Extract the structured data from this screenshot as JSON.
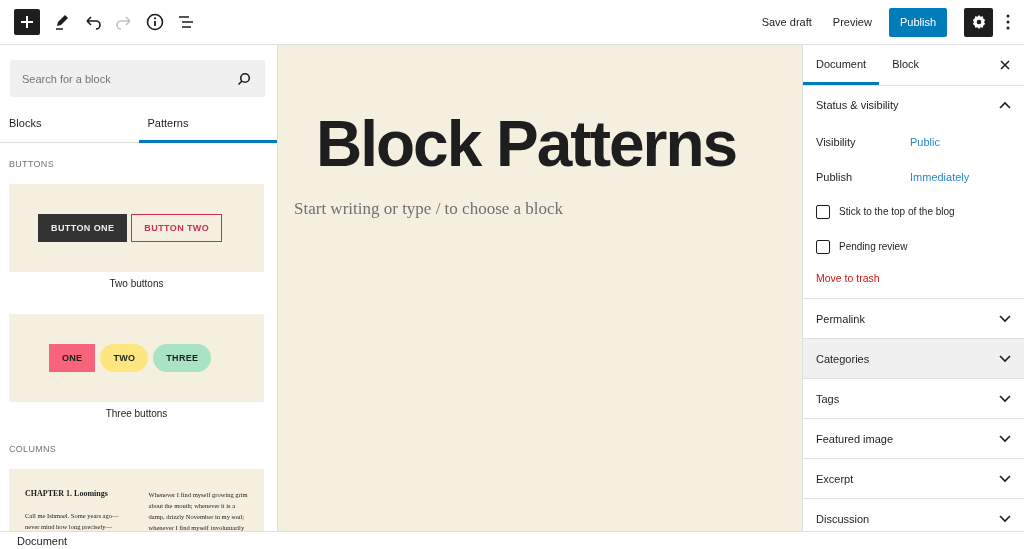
{
  "top_bar": {
    "save_draft": "Save draft",
    "preview": "Preview",
    "publish": "Publish",
    "settings_active": true
  },
  "inserter": {
    "search": {
      "placeholder": "Search for a block"
    },
    "tabs": [
      {
        "label": "Blocks",
        "selected": false
      },
      {
        "label": "Patterns",
        "selected": true
      }
    ],
    "categories": [
      {
        "heading": "BUTTONS",
        "patterns": [
          {
            "kind": "buttons",
            "label": "Two buttons",
            "buttons": [
              {
                "label": "BUTTON ONE",
                "kind": "filled"
              },
              {
                "label": "BUTTON TWO",
                "kind": "outline"
              }
            ]
          },
          {
            "kind": "pills",
            "label": "Three buttons",
            "buttons": [
              {
                "label": "ONE",
                "color": "#f7637a",
                "kind": "square"
              },
              {
                "label": "TWO",
                "color": "#fde680",
                "kind": "round"
              },
              {
                "label": "THREE",
                "color": "#a8e4c4",
                "kind": "round"
              }
            ]
          }
        ]
      },
      {
        "heading": "COLUMNS",
        "patterns": [
          {
            "kind": "columns",
            "columns": [
              {
                "heading": "CHAPTER 1. Loomings",
                "lines": [
                  "Call me Ishmael. Some years ago—",
                  "never mind how long precisely—"
                ]
              },
              {
                "lines": [
                  "Whenever I find myself growing grim",
                  "about the mouth; whenever it is a",
                  "damp, drizzly November in my soul;",
                  "whenever I find myself involuntarily"
                ]
              }
            ]
          }
        ]
      }
    ]
  },
  "editor": {
    "title": "Block Patterns",
    "placeholder": "Start writing or type / to choose a block"
  },
  "settings": {
    "tabs": [
      {
        "label": "Document",
        "selected": true
      },
      {
        "label": "Block",
        "selected": false
      }
    ],
    "status": {
      "title": "Status & visibility",
      "expanded": true,
      "rows": [
        {
          "label": "Visibility",
          "value": "Public"
        },
        {
          "label": "Publish",
          "value": "Immediately"
        }
      ],
      "checkboxes": [
        {
          "label": "Stick to the top of the blog",
          "checked": false
        },
        {
          "label": "Pending review",
          "checked": false
        }
      ],
      "trash": "Move to trash"
    },
    "panels": [
      {
        "title": "Permalink",
        "expanded": false,
        "highlighted": false
      },
      {
        "title": "Categories",
        "expanded": false,
        "highlighted": true
      },
      {
        "title": "Tags",
        "expanded": false,
        "highlighted": false
      },
      {
        "title": "Featured image",
        "expanded": false,
        "highlighted": false
      },
      {
        "title": "Excerpt",
        "expanded": false,
        "highlighted": false
      },
      {
        "title": "Discussion",
        "expanded": false,
        "highlighted": false
      }
    ]
  },
  "footer": {
    "breadcrumb": "Document"
  }
}
